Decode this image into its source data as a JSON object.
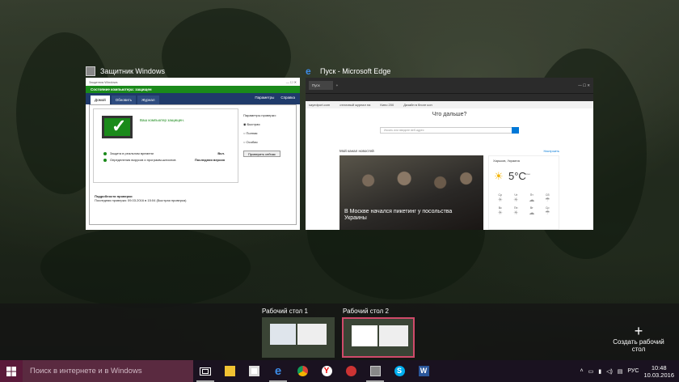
{
  "windows": [
    {
      "title": "Защитник Windows",
      "titlebar": "Защитник Windows",
      "status": "Состояние компьютера: защищен",
      "tabs": [
        "Домой",
        "Обновить",
        "Журнал"
      ],
      "top_links": [
        "Параметры",
        "Справка"
      ],
      "protected_text": "Ваш компьютер защищен.",
      "rows": [
        {
          "label": "Защита в реальном времени",
          "value": "Вкл."
        },
        {
          "label": "Определения вирусов и программ-шпионов",
          "value": "Последняя версия"
        }
      ],
      "scan_options_title": "Параметры проверки:",
      "scan_options": [
        "Быстрая",
        "Полная",
        "Особая"
      ],
      "scan_button": "Проверить сейчас",
      "details_title": "Подробности проверки",
      "details_text": "Последняя проверка: 09.03.2016 в 15:04 (Быстрая проверка)"
    },
    {
      "title": "Пуск - Microsoft Edge",
      "tab": "Пуск",
      "favorites": [
        "sayedport.com",
        "отличный журнал на",
        "Кино 200",
        "Дизайн в блоге кон"
      ],
      "headline": "Что дальше?",
      "search_placeholder": "Искать или введите веб-адрес",
      "feed_label": "Мой канал новостей",
      "feed_setup": "Настроить",
      "news_caption": "В Москве начался пикетинг у посольства Украины",
      "weather_city": "Харьков, Украина",
      "weather_temp": "5°C",
      "weather_desc": "Ясно",
      "weather_days": [
        "Ср",
        "Чт",
        "Пт",
        "Сб",
        "Вс",
        "Пн",
        "Вт",
        "Ср"
      ]
    }
  ],
  "desktops": [
    {
      "label": "Рабочий стол 1",
      "active": false
    },
    {
      "label": "Рабочий стол 2",
      "active": true
    }
  ],
  "new_desktop_label": "Создать рабочий стол",
  "taskbar": {
    "search_placeholder": "Поиск в интернете и в Windows",
    "apps": [
      "task-view-icon",
      "file-explorer-icon",
      "store-icon",
      "edge-icon",
      "chrome-icon",
      "yandex-icon",
      "ccleaner-icon",
      "defender-icon",
      "skype-icon",
      "word-icon"
    ],
    "language": "РУС",
    "time": "10:48",
    "date": "10.03.2016"
  },
  "colors": {
    "taskbar_bg": "#1a1220",
    "search_bg": "#5a2a40",
    "defender_green": "#1a8a1a",
    "active_desktop_border": "#d04a6a"
  }
}
